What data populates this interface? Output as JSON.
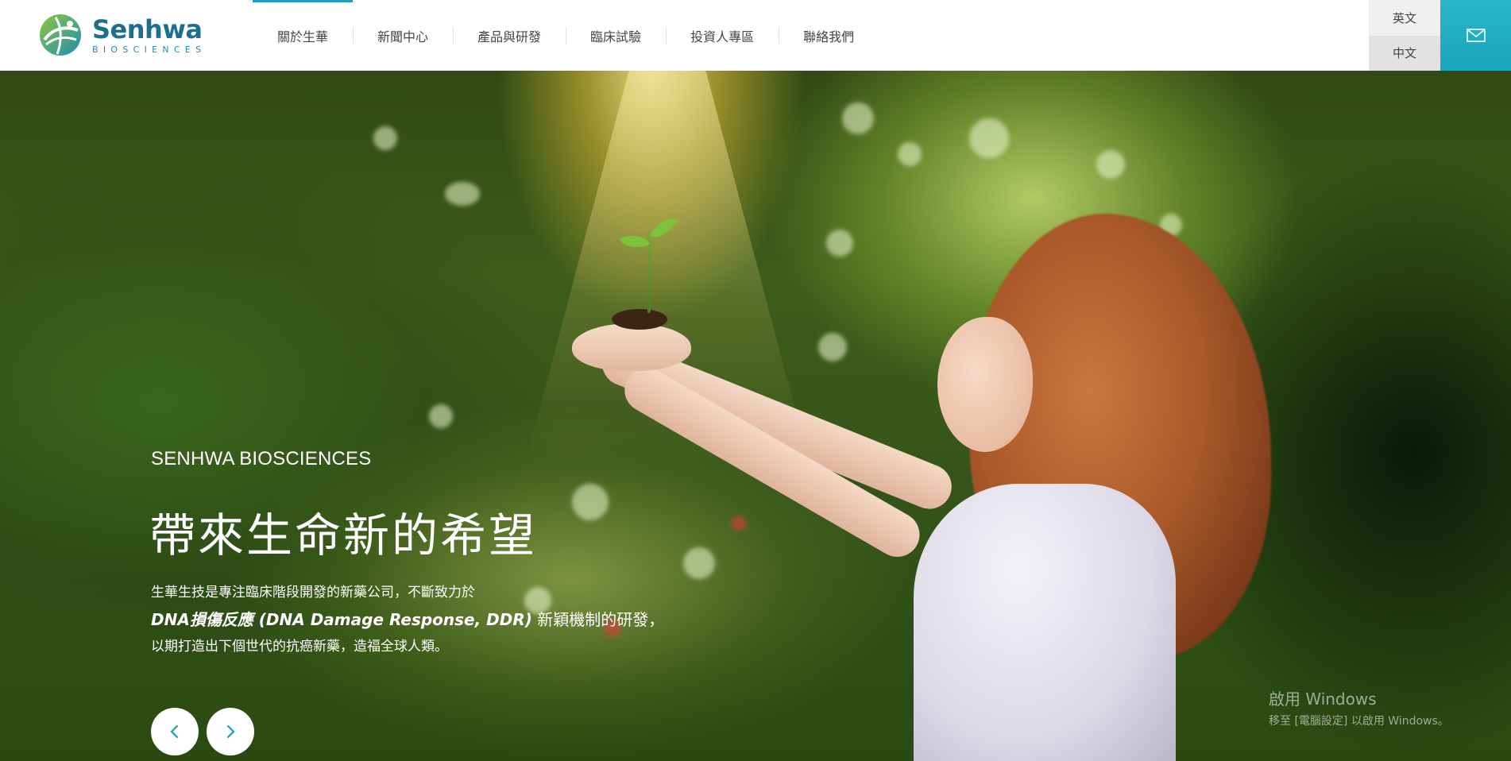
{
  "logo": {
    "name": "Senhwa",
    "subtitle": "BIOSCIENCES"
  },
  "nav": {
    "items": [
      {
        "label": "關於生華",
        "active": true
      },
      {
        "label": "新聞中心",
        "active": false
      },
      {
        "label": "產品與研發",
        "active": false
      },
      {
        "label": "臨床試驗",
        "active": false
      },
      {
        "label": "投資人專區",
        "active": false
      },
      {
        "label": "聯絡我們",
        "active": false
      }
    ]
  },
  "language": {
    "options": [
      "英文",
      "中文"
    ],
    "current": "中文"
  },
  "contact": {
    "icon": "mail-icon"
  },
  "hero": {
    "overline": "SENHWA BIOSCIENCES",
    "title": "帶來生命新的希望",
    "desc_line1": "生華生技是專注臨床階段開發的新藥公司，不斷致力於",
    "desc_line2_emphasis": "DNA損傷反應 (DNA Damage Response, DDR)",
    "desc_line2_rest": " 新穎機制的研發，",
    "desc_line3": "以期打造出下個世代的抗癌新藥，造福全球人類。",
    "prev_icon": "chevron-left-icon",
    "next_icon": "chevron-right-icon"
  },
  "windows_watermark": {
    "title": "啟用 Windows",
    "subtitle": "移至 [電腦設定] 以啟用 Windows。"
  },
  "colors": {
    "brand": "#1d6f8f",
    "accent": "#1e9fc2",
    "mail_button": "#1aa6bd"
  }
}
